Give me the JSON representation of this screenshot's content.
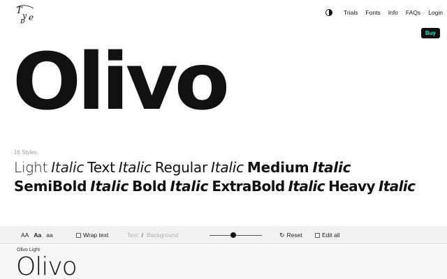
{
  "brand": {
    "logo_icon": "type-monogram-logo"
  },
  "nav": {
    "theme_icon": "contrast-icon",
    "links": [
      "Trials",
      "Fonts",
      "Info",
      "FAQs",
      "Login"
    ]
  },
  "buy": {
    "label": "Buy",
    "colors": {
      "background": "#0f0f0f",
      "text": "#2fe0c4"
    }
  },
  "hero": {
    "title": "Olivo"
  },
  "styles": {
    "count": "16 Styles",
    "row1": [
      "Light",
      "Italic",
      "Text",
      "Italic",
      "Regular",
      "Italic",
      "Medium",
      "Italic"
    ],
    "row2": [
      "SemiBold",
      "Italic",
      "Bold",
      "Italic",
      "ExtraBold",
      "Italic",
      "Heavy",
      "Italic"
    ]
  },
  "toolbar": {
    "case_options": [
      "AA",
      "Aa",
      "aa"
    ],
    "case_selected": "Aa",
    "wrap_label": "Wrap text",
    "wrap_checked": false,
    "text_color_label": "Text",
    "separator": "/",
    "background_color_label": "Background",
    "size_slider": {
      "value": 0.45
    },
    "reset_label": "Reset",
    "reset_icon": "rotate-icon",
    "edit_all_label": "Edit all",
    "edit_all_checked": false
  },
  "preview": {
    "style_label": "Olivo Light",
    "sample_text": "Olivo"
  }
}
